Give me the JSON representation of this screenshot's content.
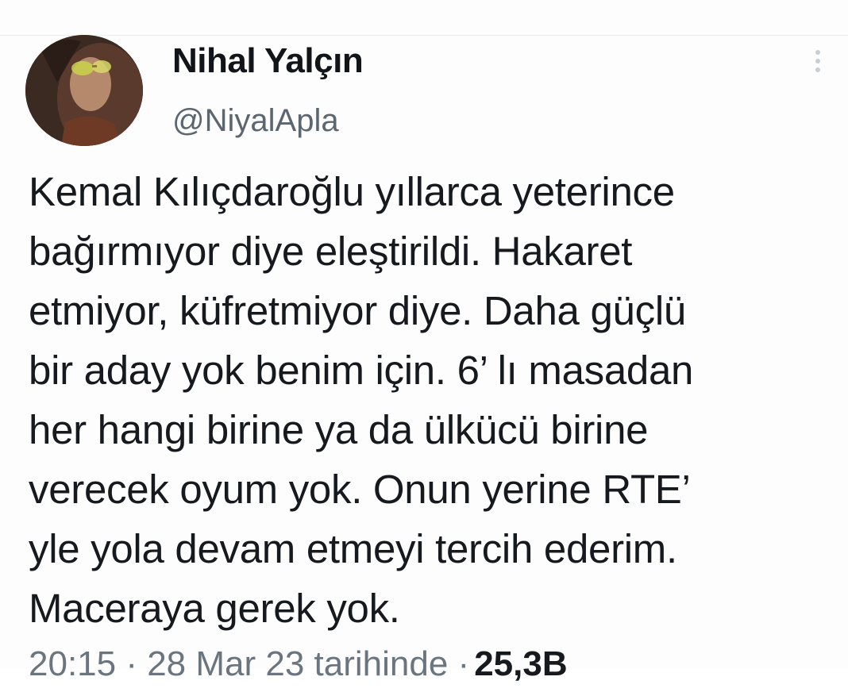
{
  "tweet": {
    "author": {
      "display_name": "Nihal Yalçın",
      "handle": "@NiyalApla",
      "avatar": "profile-photo"
    },
    "menu_icon": "more-vertical-icon",
    "text_lines": [
      "Kemal Kılıçdaroğlu yıllarca yeterince",
      "bağırmıyor diye eleştirildi. Hakaret",
      "etmiyor, küfretmiyor diye. Daha güçlü",
      "bir aday yok benim için. 6’ lı masadan",
      "her hangi birine ya da ülkücü birine",
      "verecek oyum yok. Onun yerine RTE’",
      "yle yola devam etmeyi tercih ederim.",
      "Maceraya gerek yok."
    ],
    "meta": {
      "timestamp": "20:15 · 28 Mar 23 tarihinde ·",
      "views": "25,3B"
    }
  }
}
